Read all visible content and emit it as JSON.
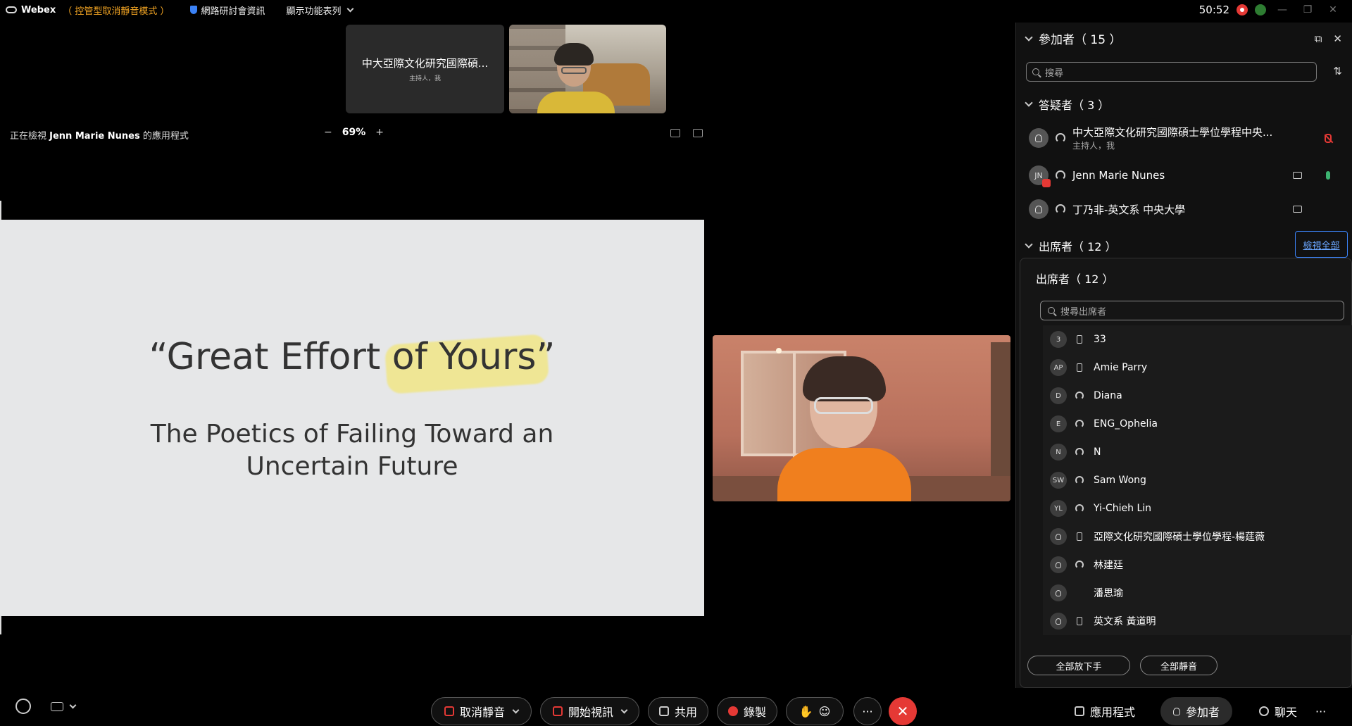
{
  "titlebar": {
    "brand": "Webex",
    "mode": "（ 控管型取消靜音模式 ）",
    "webinar_info": "網路研討會資訊",
    "show_menu": "顯示功能表列",
    "timer": "50:52",
    "minimize": "—",
    "restore": "❐",
    "close": "✕"
  },
  "thumbnails": {
    "host_name": "中大亞際文化研究國際碩...",
    "host_role": "主持人，我"
  },
  "share": {
    "prefix": "正在檢視 ",
    "owner": "Jenn Marie Nunes",
    "suffix": " 的應用程式",
    "zoom_minus": "−",
    "zoom_value": "69%",
    "zoom_plus": "+"
  },
  "slide": {
    "title": "“Great Effort of Yours”",
    "subtitle_line1": "The Poetics of Failing Toward an",
    "subtitle_line2": "Uncertain Future"
  },
  "panel": {
    "title": "參加者（ 15 ）",
    "popout": "⧉",
    "close": "✕",
    "search_placeholder": "搜尋",
    "sort": "⇅",
    "panelists_header": "答疑者（ 3 ）",
    "panelists": [
      {
        "name": "中大亞際文化研究國際碩士學位學程中央...",
        "sub": "主持人，我",
        "initials": ""
      },
      {
        "name": "Jenn Marie Nunes",
        "sub": "",
        "initials": "JN"
      },
      {
        "name": "丁乃非-英文系 中央大學",
        "sub": "",
        "initials": ""
      }
    ],
    "attendees_header": "出席者（ 12 ）",
    "view_all": "檢視全部"
  },
  "popover": {
    "title": "出席者（ 12 ）",
    "search_placeholder": "搜尋出席者",
    "attendees": [
      {
        "initials": "3",
        "name": "33",
        "device": "phone"
      },
      {
        "initials": "AP",
        "name": "Amie Parry",
        "device": "phone"
      },
      {
        "initials": "D",
        "name": "Diana",
        "device": "headset"
      },
      {
        "initials": "E",
        "name": "ENG_Ophelia",
        "device": "headset"
      },
      {
        "initials": "N",
        "name": "N",
        "device": "headset"
      },
      {
        "initials": "SW",
        "name": "Sam Wong",
        "device": "headset"
      },
      {
        "initials": "YL",
        "name": "Yi-Chieh Lin",
        "device": "headset"
      },
      {
        "initials": "",
        "name": "亞際文化研究國際碩士學位學程-楊莛薇",
        "device": "phone"
      },
      {
        "initials": "",
        "name": "林建廷",
        "device": "headset"
      },
      {
        "initials": "",
        "name": "潘思瑜",
        "device": "none"
      },
      {
        "initials": "",
        "name": "英文系 黃道明",
        "device": "phone"
      }
    ],
    "lower_all_hands": "全部放下手",
    "mute_all": "全部靜音"
  },
  "toolbar": {
    "unmute": "取消靜音",
    "start_video": "開始視訊",
    "share": "共用",
    "record": "錄製",
    "more": "···",
    "leave": "✕",
    "apps": "應用程式",
    "participants": "參加者",
    "chat": "聊天",
    "overflow": "···"
  },
  "colors": {
    "accent_blue": "#3b82f6",
    "leave_red": "#e53935",
    "mode_orange": "#f5a623",
    "mic_green": "#3cb371"
  }
}
